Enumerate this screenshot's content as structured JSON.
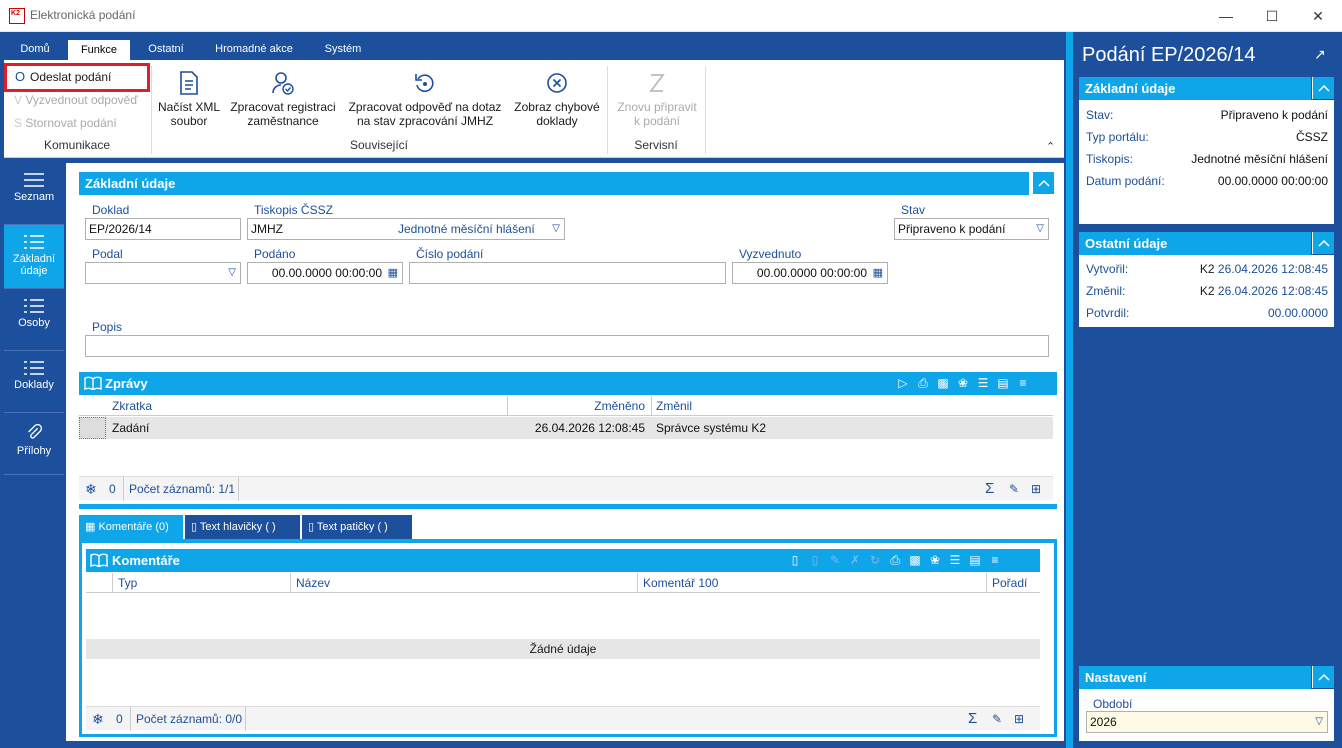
{
  "window": {
    "title": "Elektronická podání",
    "logo_text": "K2"
  },
  "ribbon": {
    "tabs": [
      "Domů",
      "Funkce",
      "Ostatní",
      "Hromadné akce",
      "Systém"
    ],
    "active_tab": "Funkce",
    "groups": {
      "komunikace": {
        "label": "Komunikace",
        "send": "Odeslat podání",
        "pickup": "Vyzvednout odpověď",
        "cancel": "Stornovat podání"
      },
      "souvisejici": {
        "label": "Související",
        "load_xml_1": "Načíst XML",
        "load_xml_2": "soubor",
        "process_reg_1": "Zpracovat registraci",
        "process_reg_2": "zaměstnance",
        "process_resp_1": "Zpracovat odpověď na dotaz",
        "process_resp_2": "na stav zpracování JMHZ",
        "show_err_1": "Zobraz chybové",
        "show_err_2": "doklady"
      },
      "servisni": {
        "label": "Servisní",
        "reprepare_1": "Znovu připravit",
        "reprepare_2": "k podání"
      }
    }
  },
  "nav": {
    "items": [
      "Seznam",
      "Základní údaje",
      "Osoby",
      "Doklady",
      "Přílohy"
    ],
    "item_b1": "Základní",
    "item_b2": "údaje",
    "active": "Základní údaje"
  },
  "basic": {
    "title": "Základní údaje",
    "doklad_label": "Doklad",
    "doklad_value": "EP/2026/14",
    "tiskopis_label": "Tiskopis ČSSZ",
    "tiskopis_code": "JMHZ",
    "tiskopis_name": "Jednotné měsíční hlášení",
    "stav_label": "Stav",
    "stav_value": "Připraveno k podání",
    "podal_label": "Podal",
    "podal_value": "",
    "podano_label": "Podáno",
    "podano_value": "00.00.0000 00:00:00",
    "cislo_label": "Číslo podání",
    "cislo_value": "",
    "vyzvednuto_label": "Vyzvednuto",
    "vyzvednuto_value": "00.00.0000 00:00:00",
    "popis_label": "Popis",
    "popis_value": ""
  },
  "zpravy": {
    "title": "Zprávy",
    "columns": [
      "Zkratka",
      "Změněno",
      "Změnil"
    ],
    "rows": [
      {
        "zkratka": "Zadání",
        "zmeneno": "26.04.2026 12:08:45",
        "zmenil": "Správce systému K2"
      }
    ],
    "selected_count": "0",
    "record_count": "Počet záznamů: 1/1"
  },
  "bottom_tabs": [
    "Komentáře (0)",
    "Text hlavičky ( )",
    "Text patičky ( )"
  ],
  "komentare": {
    "title": "Komentáře",
    "columns": [
      "Typ",
      "Název",
      "Komentář 100",
      "Pořadí"
    ],
    "empty": "Žádné údaje",
    "selected_count": "0",
    "record_count": "Počet záznamů: 0/0"
  },
  "right": {
    "title": "Podání EP/2026/14",
    "basic": {
      "title": "Základní údaje",
      "rows": [
        {
          "k": "Stav:",
          "v": "Připraveno k podání"
        },
        {
          "k": "Typ portálu:",
          "v": "ČSSZ"
        },
        {
          "k": "Tiskopis:",
          "v": "Jednotné měsíční hlášení"
        },
        {
          "k": "Datum podání:",
          "v": "00.00.0000 00:00:00"
        }
      ]
    },
    "other": {
      "title": "Ostatní údaje",
      "created_label": "Vytvořil:",
      "created_user": "K2",
      "created_date": "26.04.2026 12:08:45",
      "changed_label": "Změnil:",
      "changed_user": "K2",
      "changed_date": "26.04.2026 12:08:45",
      "confirmed_label": "Potvrdil:",
      "confirmed_date": "00.00.0000"
    },
    "settings": {
      "title": "Nastavení",
      "period_label": "Období",
      "period_value": "2026"
    }
  },
  "colors": {
    "frame": "#1c4f9c",
    "accent": "#0ea5e9",
    "highlight": "#e11d2a"
  }
}
